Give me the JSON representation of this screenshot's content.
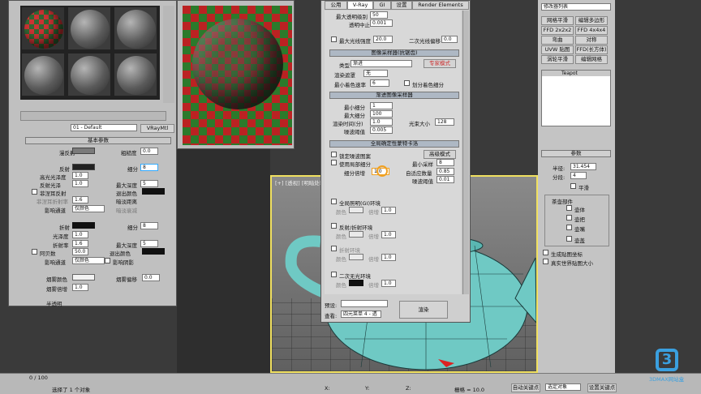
{
  "material_editor": {
    "material_name": "01 - Default",
    "material_type": "VRayMtl",
    "rollout_basic": "基本参数",
    "diffuse": "漫反射",
    "roughness": "粗糙度",
    "roughness_val": "0.0",
    "reflect": "反射",
    "gloss": "细分",
    "gloss_val": "8",
    "hilight_gloss": "高光光泽度",
    "hilight_val": "1.0",
    "L": "L",
    "refl_gloss": "反射光泽",
    "refl_gloss_val": "1.0",
    "fresnel": "菲涅耳反射",
    "fresnel_ior": "菲涅耳折射率",
    "fresnel_ior_val": "1.6",
    "max_depth": "最大深度",
    "max_depth_val": "5",
    "use_interp": "使用插值",
    "exit_color": "退出颜色",
    "dim_dist": "暗淡距离",
    "dim_falloff": "暗淡衰减",
    "affect_ch": "影响通道",
    "affect_ch_val": "仅颜色",
    "refract": "折射",
    "refr_subdiv_val": "8",
    "refr_gloss": "光泽度",
    "refr_gloss_val": "1.0",
    "ior": "折射率",
    "ior_val": "1.6",
    "refr_max_depth_val": "5",
    "abbe": "阿贝数",
    "abbe_val": "50.0",
    "refr_exit_color": "退出颜色",
    "affect_shadows": "影响阴影",
    "fog_color": "烟雾颜色",
    "fog_bias": "烟雾偏移",
    "fog_bias_val": "0.0",
    "fog_mult": "烟雾倍增",
    "fog_mult_val": "1.0",
    "translucency": "半透明",
    "misc": "AA: 8/8; px: 0.00300"
  },
  "render_setup": {
    "tabs": [
      "公用",
      "V-Ray",
      "GI",
      "设置",
      "Render Elements"
    ],
    "active_tab": "V-Ray",
    "max_trans_level": "最大透明级别",
    "max_trans_val": "50",
    "trans_cutoff": "透明中止",
    "trans_cutoff_val": "0.001",
    "max_ray_int": "最大光线强度",
    "max_ray_int_val": "20.0",
    "sec_ray_bias": "二次光线偏移",
    "sec_ray_bias_val": "0.0",
    "img_sampler_title": "图像采样器(抗锯齿)",
    "type": "类型",
    "type_val": "渐进",
    "expert_mode": "专家模式",
    "render_mask": "渲染遮罩",
    "render_mask_val": "无",
    "min_shade_rate": "最小着色速率",
    "min_shade_val": "6",
    "subdiv_color_sep": "划分着色细分",
    "prog_sampler_title": "渐进图像采样器",
    "min_subdiv": "最小细分",
    "min_subdiv_val": "1",
    "max_subdiv": "最大细分",
    "max_subdiv_val": "100",
    "render_time": "渲染时间(分)",
    "render_time_val": "1.0",
    "ray_bundle": "光束大小",
    "ray_bundle_val": "128",
    "noise_thresh": "噪波阈值",
    "noise_thresh_val": "0.005",
    "dmc_title": "全局确定性蒙特卡洛",
    "lock_noise": "锁定噪波图案",
    "adv_mode": "高级模式",
    "use_local_sub": "使用局部细分",
    "min_samples": "最小采样",
    "min_samples_val": "8",
    "subdiv_mult": "细分倍增",
    "subdiv_mult_val": "1.0",
    "adapt_amount": "自适应数量",
    "adapt_amount_val": "0.85",
    "noise_thresh2": "噪波阈值",
    "noise_thresh2_val": "0.01",
    "env_gi": "全局照明(GI)环境",
    "color": "颜色",
    "mult": "倍增",
    "mult_val": "1.0",
    "refl_refr_env": "反射/折射环境",
    "refr_env": "折射环境",
    "sec_matte": "二次无光环境",
    "preset": "预设:",
    "view": "查看:",
    "view_val": "四元菜单 4 - 透",
    "render_btn": "渲染"
  },
  "right_panel": {
    "modifier_list": "修改器列表",
    "btns": [
      "网格平滑",
      "编辑多边形",
      "FFD 2x2x2",
      "FFD 4x4x4",
      "弯曲",
      "对称",
      "UVW 贴图",
      "FFD(长方体)",
      "涡轮平滑",
      "壳",
      "壳",
      "编辑网格"
    ],
    "stack_item": "Teapot",
    "params": "参数",
    "radius": "半径:",
    "radius_val": "31.454",
    "segments": "分段:",
    "segments_val": "4",
    "smooth": "平滑",
    "parts": "茶壶部件",
    "body": "壶体",
    "handle": "壶把",
    "spout": "壶嘴",
    "lid": "壶盖",
    "gen_map": "生成贴图坐标",
    "real_world": "真实世界贴图大小"
  },
  "viewport": {
    "label": "[+] [透视] [明暗处理]"
  },
  "status": {
    "frames": "0 / 100",
    "selected": "选择了 1 个对象",
    "grid": "栅格 = 10.0",
    "autokey": "自动关键点",
    "selobj": "选定对象",
    "setkey": "设置关键点",
    "x": "X:",
    "y": "Y:",
    "z": "Z:",
    "brand": "3DMAX网站盒"
  },
  "colors": {
    "accent": "#f0a020",
    "viewport_border": "#f0e060",
    "teapot": "#6fc9c4"
  }
}
